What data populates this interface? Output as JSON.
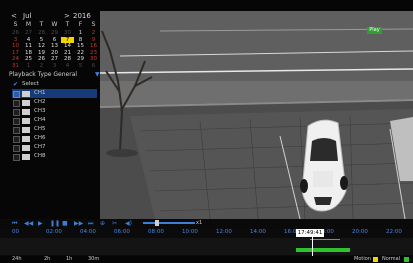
{
  "calendar": {
    "prev": "<",
    "month": "Jul",
    "next": ">",
    "year": "2016",
    "weekdays": [
      "S",
      "M",
      "T",
      "W",
      "T",
      "F",
      "S"
    ],
    "days": [
      {
        "d": "26",
        "c": "faint"
      },
      {
        "d": "27",
        "c": "faint"
      },
      {
        "d": "28",
        "c": "faint"
      },
      {
        "d": "29",
        "c": "faint"
      },
      {
        "d": "30",
        "c": "faint"
      },
      {
        "d": "1",
        "c": ""
      },
      {
        "d": "2",
        "c": "red"
      },
      {
        "d": "3",
        "c": "red"
      },
      {
        "d": "4",
        "c": "rec"
      },
      {
        "d": "5",
        "c": "rec"
      },
      {
        "d": "6",
        "c": "rec"
      },
      {
        "d": "7",
        "c": "sel"
      },
      {
        "d": "8",
        "c": "rec"
      },
      {
        "d": "9",
        "c": "red"
      },
      {
        "d": "10",
        "c": "red"
      },
      {
        "d": "11",
        "c": "rec"
      },
      {
        "d": "12",
        "c": "rec"
      },
      {
        "d": "13",
        "c": "rec"
      },
      {
        "d": "14",
        "c": "rec"
      },
      {
        "d": "15",
        "c": "rec"
      },
      {
        "d": "16",
        "c": "red"
      },
      {
        "d": "17",
        "c": "red"
      },
      {
        "d": "18",
        "c": "rec"
      },
      {
        "d": "19",
        "c": "rec"
      },
      {
        "d": "20",
        "c": "rec"
      },
      {
        "d": "21",
        "c": "rec"
      },
      {
        "d": "22",
        "c": "rec"
      },
      {
        "d": "23",
        "c": "red"
      },
      {
        "d": "24",
        "c": "red"
      },
      {
        "d": "25",
        "c": "rec"
      },
      {
        "d": "26",
        "c": "rec"
      },
      {
        "d": "27",
        "c": "rec"
      },
      {
        "d": "28",
        "c": "rec"
      },
      {
        "d": "29",
        "c": "rec"
      },
      {
        "d": "30",
        "c": "red"
      },
      {
        "d": "31",
        "c": "red"
      },
      {
        "d": "1",
        "c": "faint"
      },
      {
        "d": "2",
        "c": "faint"
      },
      {
        "d": "3",
        "c": "faint"
      },
      {
        "d": "4",
        "c": "faint"
      },
      {
        "d": "5",
        "c": "faint"
      },
      {
        "d": "6",
        "c": "faint"
      }
    ]
  },
  "playback_type": {
    "label": "Playback Type",
    "value": "General",
    "dropdown_icon": "chevron-down-icon"
  },
  "channels": {
    "select_label": "Select",
    "items": [
      {
        "label": "CH1",
        "checked": true,
        "selected": true
      },
      {
        "label": "CH2",
        "checked": false,
        "selected": false
      },
      {
        "label": "CH3",
        "checked": false,
        "selected": false
      },
      {
        "label": "CH4",
        "checked": false,
        "selected": false
      },
      {
        "label": "CH5",
        "checked": false,
        "selected": false
      },
      {
        "label": "CH6",
        "checked": false,
        "selected": false
      },
      {
        "label": "CH7",
        "checked": false,
        "selected": false
      },
      {
        "label": "CH8",
        "checked": false,
        "selected": false
      }
    ]
  },
  "video": {
    "badge": "Play"
  },
  "toolbar": {
    "icons": [
      "rewind-icon",
      "step-back-icon",
      "play-icon",
      "pause-icon",
      "stop-icon",
      "fast-forward-icon",
      "zoom-icon",
      "volume-icon",
      "speed-slider"
    ],
    "speed_value": "x1"
  },
  "timeline": {
    "labels": [
      "00",
      "02:00",
      "04:00",
      "06:00",
      "08:00",
      "10:00",
      "12:00",
      "14:00",
      "16:00",
      "18:00",
      "20:00",
      "22:00"
    ],
    "current_time": "17:49:41"
  },
  "bottombar": {
    "left": [
      "24h",
      "2h",
      "1h",
      "30m"
    ],
    "legend_motion": "Motion",
    "legend_normal": "Normal"
  },
  "colors": {
    "selected_day": "#f1d400",
    "record": "#2fc22f",
    "motion": "#f1d400",
    "accent": "#3d7fd6"
  }
}
